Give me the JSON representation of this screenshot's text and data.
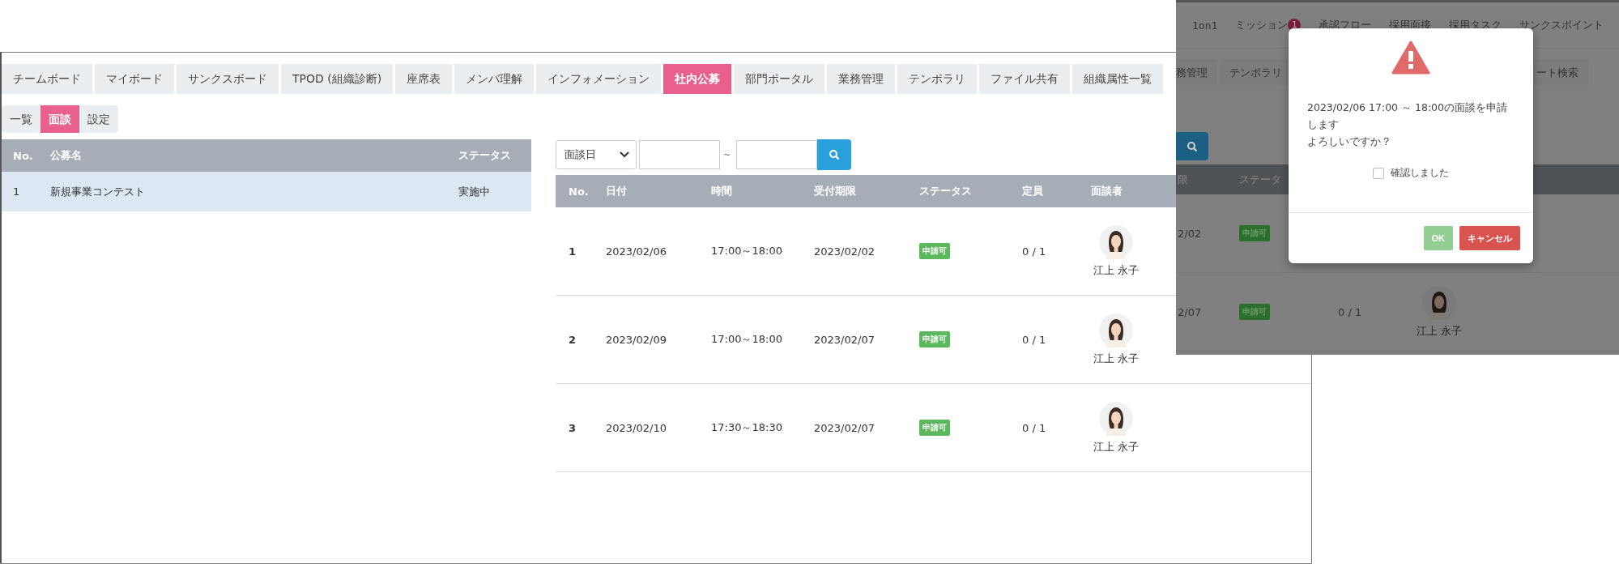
{
  "main": {
    "tabs": [
      {
        "label": "チームボード",
        "selected": false
      },
      {
        "label": "マイボード",
        "selected": false
      },
      {
        "label": "サンクスボード",
        "selected": false
      },
      {
        "label": "TPOD (組織診断)",
        "selected": false
      },
      {
        "label": "座席表",
        "selected": false
      },
      {
        "label": "メンバ理解",
        "selected": false
      },
      {
        "label": "インフォメーション",
        "selected": false
      },
      {
        "label": "社内公募",
        "selected": true
      },
      {
        "label": "部門ポータル",
        "selected": false
      },
      {
        "label": "業務管理",
        "selected": false
      },
      {
        "label": "テンポラリ",
        "selected": false
      },
      {
        "label": "ファイル共有",
        "selected": false
      },
      {
        "label": "組織属性一覧",
        "selected": false
      }
    ],
    "subtabs": [
      {
        "label": "一覧",
        "selected": false
      },
      {
        "label": "面談",
        "selected": true
      },
      {
        "label": "設定",
        "selected": false
      }
    ],
    "recruit_table": {
      "columns": [
        "No.",
        "公募名",
        "ステータス"
      ],
      "rows": [
        {
          "no": "1",
          "name": "新規事業コンテスト",
          "status": "実施中",
          "selected": true
        }
      ]
    },
    "filter": {
      "select": "面談日",
      "separator": "~"
    },
    "interview_table": {
      "columns": [
        "No.",
        "日付",
        "時間",
        "受付期限",
        "ステータス",
        "定員",
        "面談者"
      ],
      "rows": [
        {
          "no": "1",
          "date": "2023/02/06",
          "time": "17:00～18:00",
          "deadline": "2023/02/02",
          "status": "申請可",
          "capacity": "0 / 1",
          "interviewer": "江上 永子"
        },
        {
          "no": "2",
          "date": "2023/02/09",
          "time": "17:00～18:00",
          "deadline": "2023/02/07",
          "status": "申請可",
          "capacity": "0 / 1",
          "interviewer": "江上 永子"
        },
        {
          "no": "3",
          "date": "2023/02/10",
          "time": "17:30～18:30",
          "deadline": "2023/02/07",
          "status": "申請可",
          "capacity": "0 / 1",
          "interviewer": "江上 永子"
        }
      ]
    }
  },
  "overlay": {
    "nav": [
      {
        "label": "1on1"
      },
      {
        "label": "ミッション",
        "badge": "1"
      },
      {
        "label": "承認フロー"
      },
      {
        "label": "採用面接"
      },
      {
        "label": "採用タスク"
      },
      {
        "label": "サンクスポイント"
      }
    ],
    "tabs": [
      "務管理",
      "テンポラリ",
      "ート検索"
    ],
    "table": {
      "columns": [
        "限",
        "ステータ"
      ],
      "rows": [
        {
          "deadline": "2/02",
          "status": "申請可"
        },
        {
          "deadline": "2/07",
          "status": "申請可",
          "capacity": "0 / 1",
          "interviewer": "江上 永子"
        }
      ]
    },
    "dialog": {
      "message": [
        "2023/02/06 17:00 ～ 18:00の面談を申請します",
        "よろしいですか？"
      ],
      "checkbox": {
        "label": "確認しました",
        "checked": false
      },
      "buttons": [
        {
          "label": "OK",
          "kind": "ok",
          "disabled": true
        },
        {
          "label": "キャンセル",
          "kind": "cancel",
          "disabled": false
        }
      ]
    }
  }
}
